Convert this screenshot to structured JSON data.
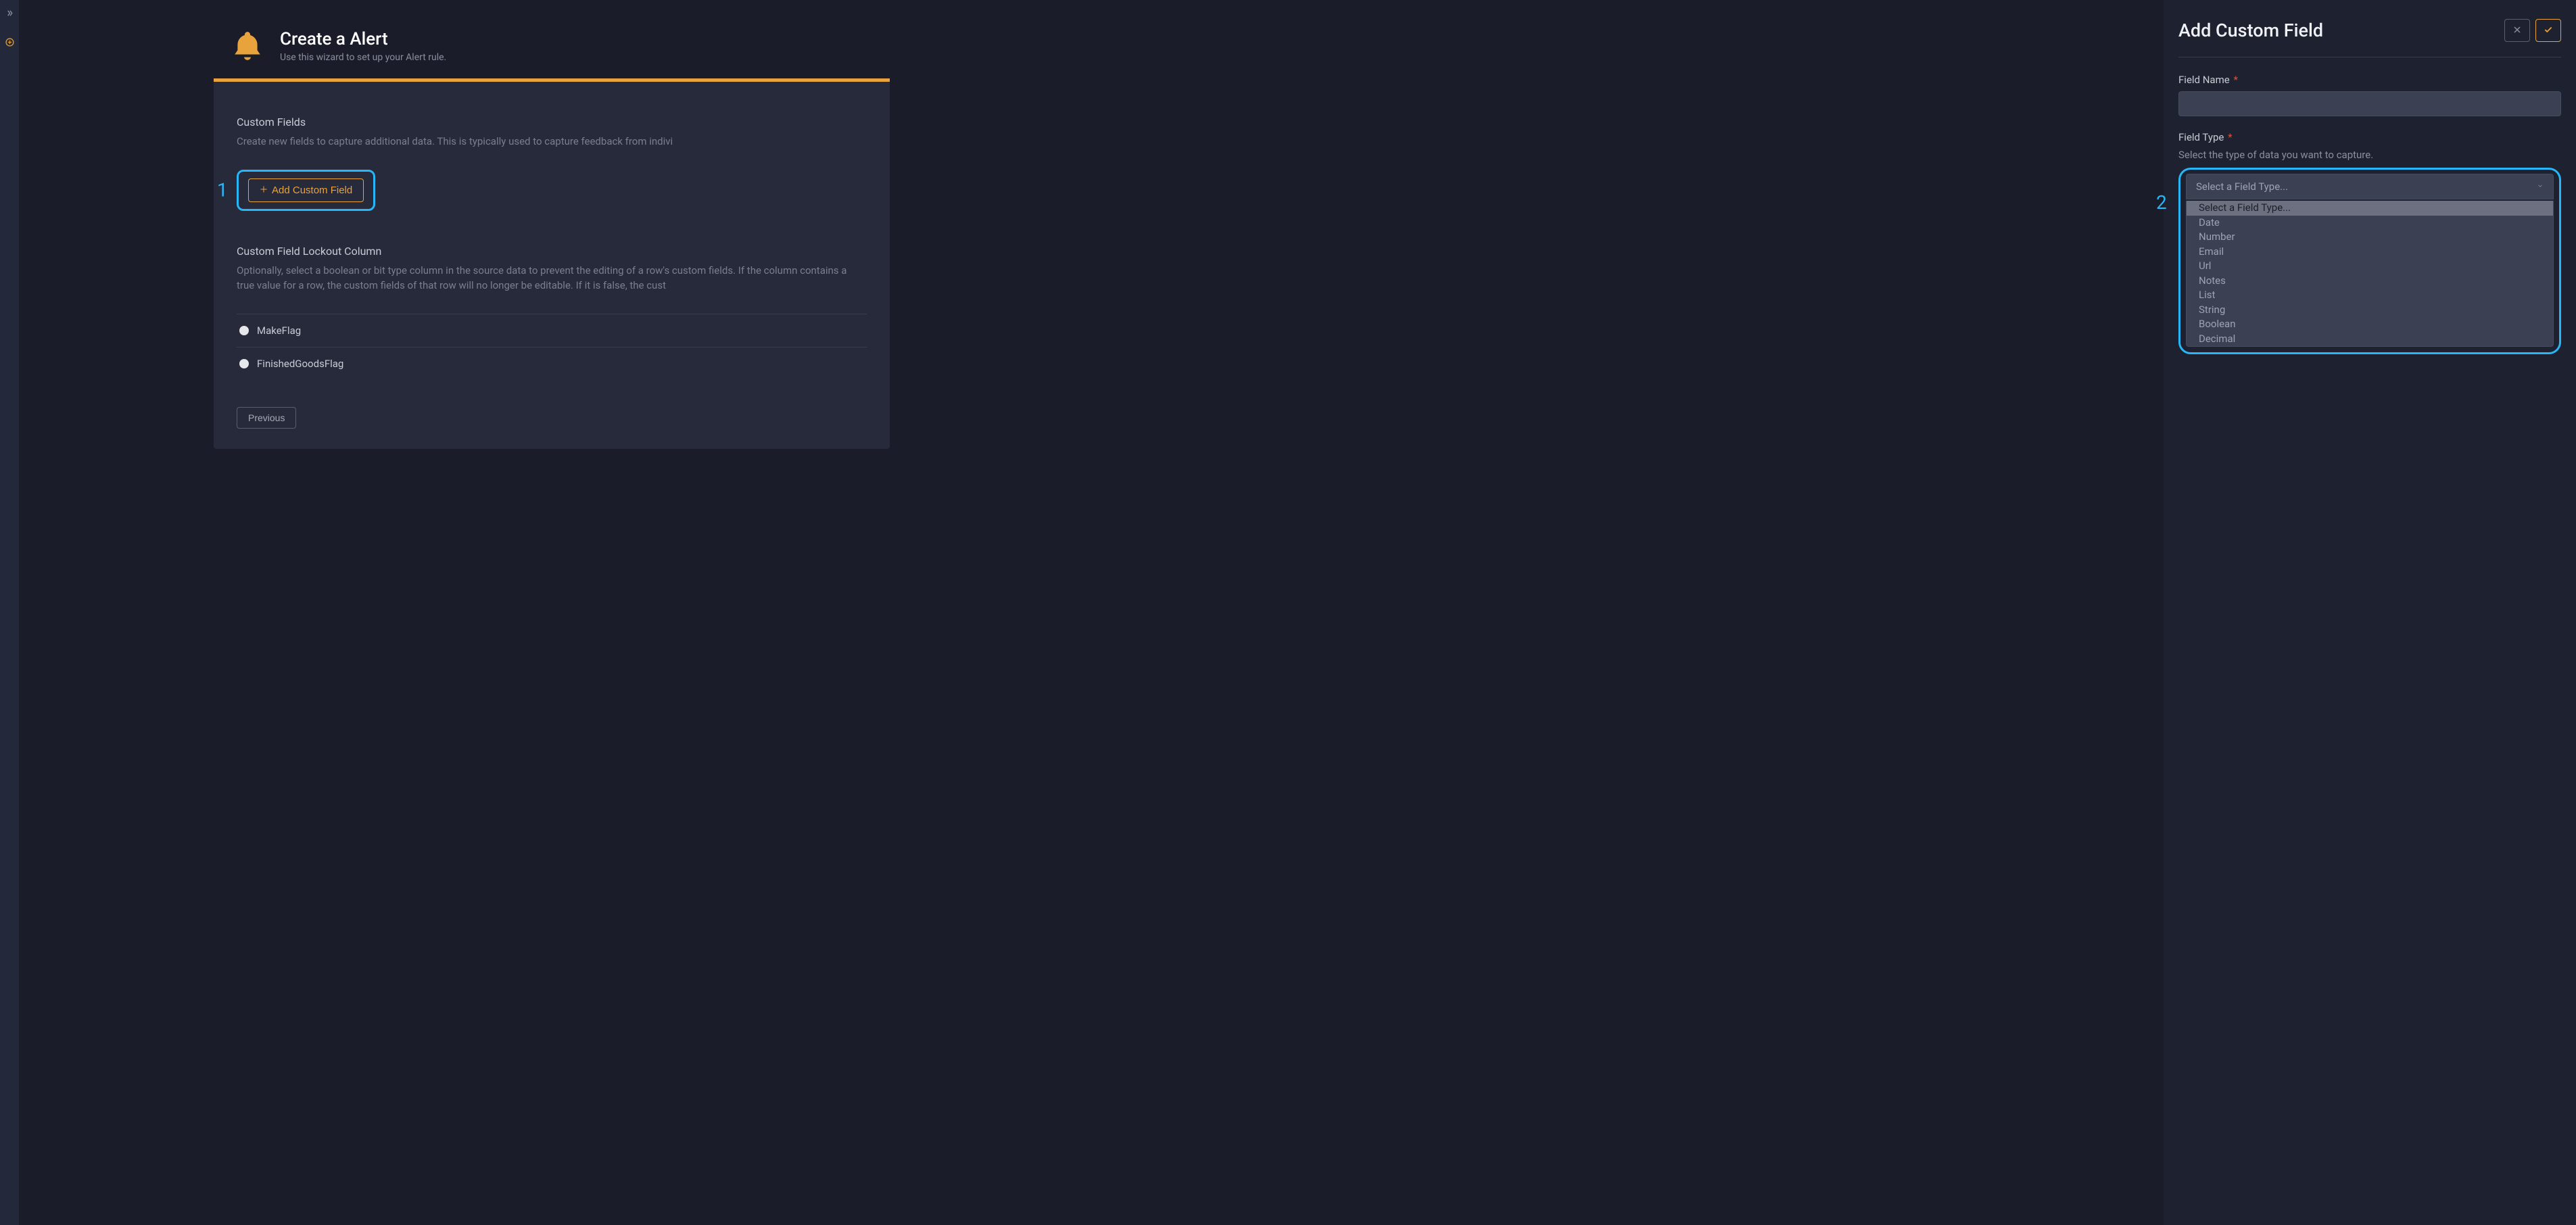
{
  "rail": {
    "expand_icon": "expand",
    "add_icon": "add"
  },
  "header": {
    "title": "Create a Alert",
    "subtitle": "Use this wizard to set up your Alert rule."
  },
  "customFields": {
    "title": "Custom Fields",
    "desc": "Create new fields to capture additional data. This is typically used to capture feedback from indivi",
    "add_button": "Add Custom Field"
  },
  "callouts": {
    "one": "1",
    "two": "2"
  },
  "lockout": {
    "title": "Custom Field Lockout Column",
    "desc": "Optionally, select a boolean or bit type column in the source data to prevent the editing of a row's custom fields. If the column contains a true value for a row, the custom fields of that row will no longer be editable. If it is false, the cust",
    "options": [
      "MakeFlag",
      "FinishedGoodsFlag"
    ]
  },
  "buttons": {
    "previous": "Previous"
  },
  "drawer": {
    "title": "Add Custom Field",
    "field_name_label": "Field Name",
    "field_type_label": "Field Type",
    "field_type_hint": "Select the type of data you want to capture.",
    "select_placeholder": "Select a Field Type...",
    "options": [
      "Select a Field Type...",
      "Date",
      "Number",
      "Email",
      "Url",
      "Notes",
      "List",
      "String",
      "Boolean",
      "Decimal"
    ],
    "required": "*"
  }
}
